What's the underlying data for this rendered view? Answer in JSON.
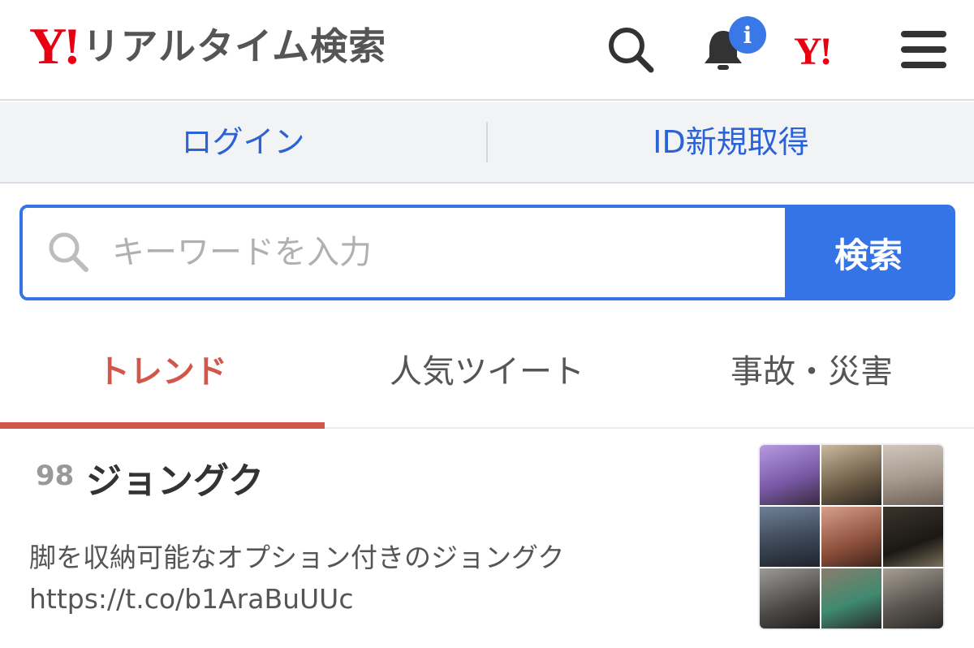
{
  "header": {
    "logo_mark": "Y!",
    "logo_text": "リアルタイム検索",
    "notification_badge": "i",
    "yahoo_link_mark": "Y!"
  },
  "account": {
    "login_label": "ログイン",
    "register_label": "ID新規取得"
  },
  "search": {
    "placeholder": "キーワードを入力",
    "value": "",
    "button_label": "検索"
  },
  "tabs": [
    {
      "label": "トレンド",
      "active": true
    },
    {
      "label": "人気ツイート",
      "active": false
    },
    {
      "label": "事故・災害",
      "active": false
    }
  ],
  "trend": {
    "rank": "98",
    "title": "ジョングク",
    "description": "脚を収納可能なオプション付きのジョングク",
    "url": "https://t.co/b1AraBuUUc"
  },
  "colors": {
    "brand_red": "#e60012",
    "accent_blue": "#3574e6",
    "link_blue": "#2b63d6",
    "active_tab": "#d2574b"
  },
  "icons": [
    "search-icon",
    "bell-icon",
    "menu-icon"
  ]
}
